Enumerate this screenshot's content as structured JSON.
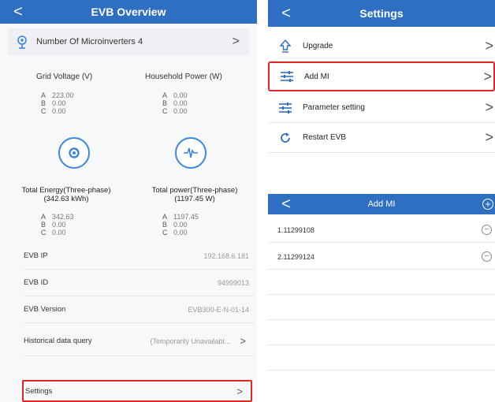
{
  "overview": {
    "title": "EVB Overview",
    "back_icon": "<",
    "microinverters_label": "Number Of Microinverters 4",
    "grid_voltage_title": "Grid Voltage  (V)",
    "household_power_title": "Household Power  (W)",
    "grid_voltage": [
      {
        "phase": "A",
        "value": "223.00"
      },
      {
        "phase": "B",
        "value": "0.00"
      },
      {
        "phase": "C",
        "value": "0.00"
      }
    ],
    "household_power": [
      {
        "phase": "A",
        "value": "0.00"
      },
      {
        "phase": "B",
        "value": "0.00"
      },
      {
        "phase": "C",
        "value": "0.00"
      }
    ],
    "total_energy_title": "Total Energy(Three-phase)",
    "total_energy_value": "(342.63 kWh)",
    "total_power_title": "Total power(Three-phase)",
    "total_power_value": "(1197.45 W)",
    "total_energy": [
      {
        "phase": "A",
        "value": "342.63"
      },
      {
        "phase": "B",
        "value": "0.00"
      },
      {
        "phase": "C",
        "value": "0.00"
      }
    ],
    "total_power": [
      {
        "phase": "A",
        "value": "1197.45"
      },
      {
        "phase": "B",
        "value": "0.00"
      },
      {
        "phase": "C",
        "value": "0.00"
      }
    ],
    "evb_ip_label": "EVB IP",
    "evb_ip_value": "192.168.6.181",
    "evb_id_label": "EVB ID",
    "evb_id_value": "94999013",
    "evb_version_label": "EVB Version",
    "evb_version_value": "EVB300-E-N-01-14",
    "historical_label": "Historical data query",
    "historical_value": "(Temporarily Unavailabl...",
    "settings_label": "Settings",
    "chevron": ">"
  },
  "settings": {
    "title": "Settings",
    "items": [
      {
        "label": "Upgrade",
        "icon": "upload-icon"
      },
      {
        "label": "Add MI",
        "icon": "sliders-icon"
      },
      {
        "label": "Parameter setting",
        "icon": "sliders-icon"
      },
      {
        "label": "Restart EVB",
        "icon": "restart-icon"
      }
    ]
  },
  "add_mi": {
    "title": "Add MI",
    "plus_icon": "+",
    "minus_icon": "−",
    "items": [
      {
        "label": "1.11299108"
      },
      {
        "label": "2.11299124"
      }
    ]
  },
  "colors": {
    "header_blue": "#2f6fc2",
    "highlight_red": "#e02626",
    "accent_blue": "#3c86e0"
  }
}
